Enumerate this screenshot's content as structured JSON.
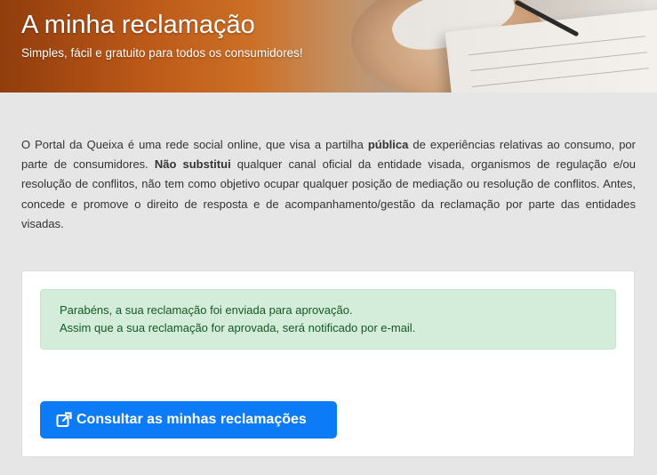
{
  "hero": {
    "title": "A minha reclamação",
    "subtitle": "Simples, fácil e gratuito para todos os consumidores!"
  },
  "intro": {
    "part1": "O Portal da Queixa é uma rede social online, que visa a partilha ",
    "bold1": "pública",
    "part2": " de experiências relativas ao consumo, por parte de consumidores. ",
    "bold2": "Não substitui",
    "part3": " qualquer canal oficial da entidade visada, organismos de regulação e/ou resolução de conflitos, não tem como objetivo ocupar qualquer posição de mediação ou resolução de conflitos. Antes, concede e promove o direito de resposta e de acompanhamento/gestão da reclamação por parte das entidades visadas."
  },
  "alert": {
    "line1": "Parabéns, a sua reclamação foi enviada para aprovação.",
    "line2": "Assim que a sua reclamação for aprovada, será notificado por e-mail."
  },
  "button": {
    "label": "Consultar as minhas reclamações",
    "icon": "external-link-icon"
  },
  "colors": {
    "page_background": "#e6e6e6",
    "alert_background": "#d4edda",
    "alert_text": "#155724",
    "button_background": "#0d7bf5"
  }
}
